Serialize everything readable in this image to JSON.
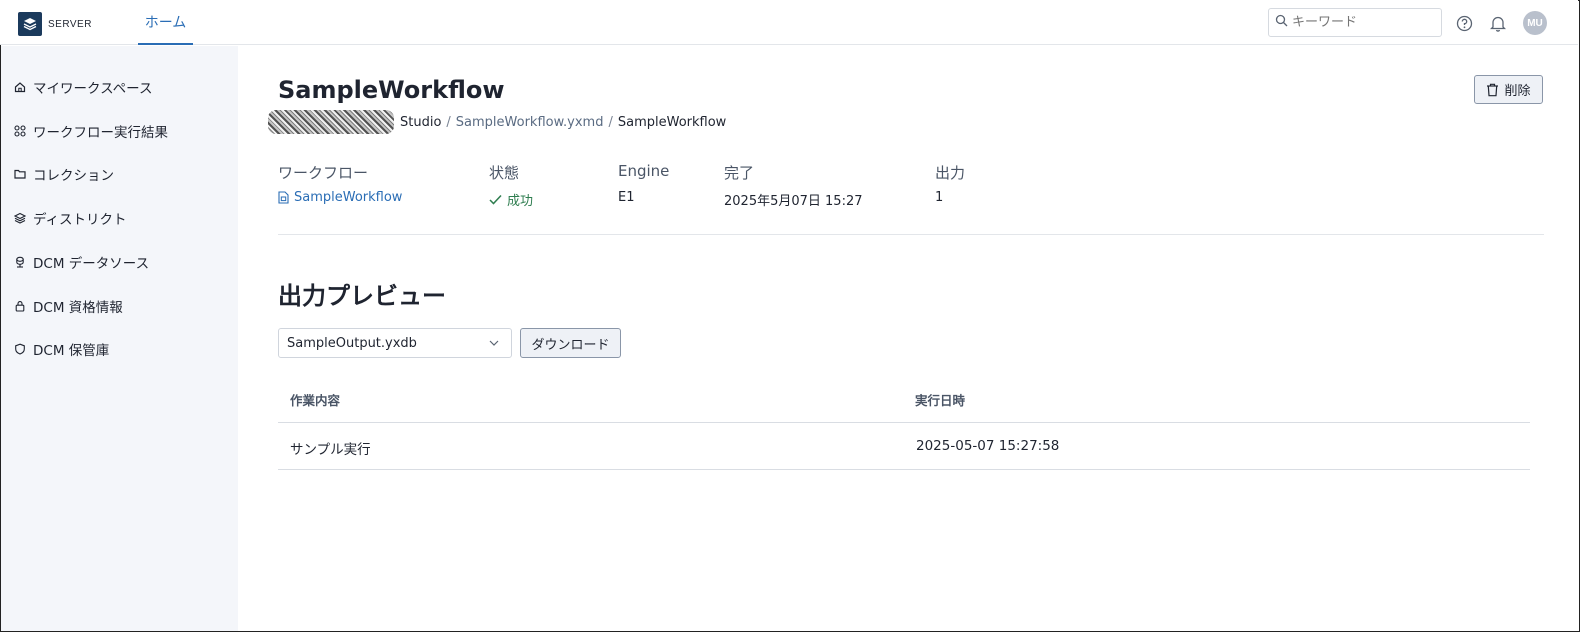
{
  "header": {
    "brand": "SERVER",
    "nav_home": "ホーム",
    "search_placeholder": "キーワード",
    "avatar_initials": "MU",
    "accent_color": "#2a6db5"
  },
  "sidebar": {
    "items": [
      {
        "label": "マイワークスペース",
        "icon": "home-icon"
      },
      {
        "label": "ワークフロー実行結果",
        "icon": "nodes-icon"
      },
      {
        "label": "コレクション",
        "icon": "folder-icon"
      },
      {
        "label": "ディストリクト",
        "icon": "layers-icon"
      },
      {
        "label": "DCM データソース",
        "icon": "datasource-icon"
      },
      {
        "label": "DCM 資格情報",
        "icon": "lock-icon"
      },
      {
        "label": "DCM 保管庫",
        "icon": "shield-icon"
      }
    ]
  },
  "main": {
    "title": "SampleWorkflow",
    "delete_label": "削除",
    "breadcrumb": {
      "first": "Studio",
      "second": "SampleWorkflow.yxmd",
      "current": "SampleWorkflow",
      "separator": "/"
    },
    "info": {
      "workflow_label": "ワークフロー",
      "workflow_value": "SampleWorkflow",
      "status_label": "状態",
      "status_value": "成功",
      "engine_label": "Engine",
      "engine_value": "E1",
      "completed_label": "完了",
      "completed_value": "2025年5月07日 15:27",
      "output_label": "出力",
      "output_value": "1"
    },
    "preview": {
      "title": "出力プレビュー",
      "selected_output": "SampleOutput.yxdb",
      "download_label": "ダウンロード",
      "columns": [
        "作業内容",
        "実行日時"
      ],
      "rows": [
        [
          "サンプル実行",
          "2025-05-07 15:27:58"
        ]
      ]
    }
  }
}
